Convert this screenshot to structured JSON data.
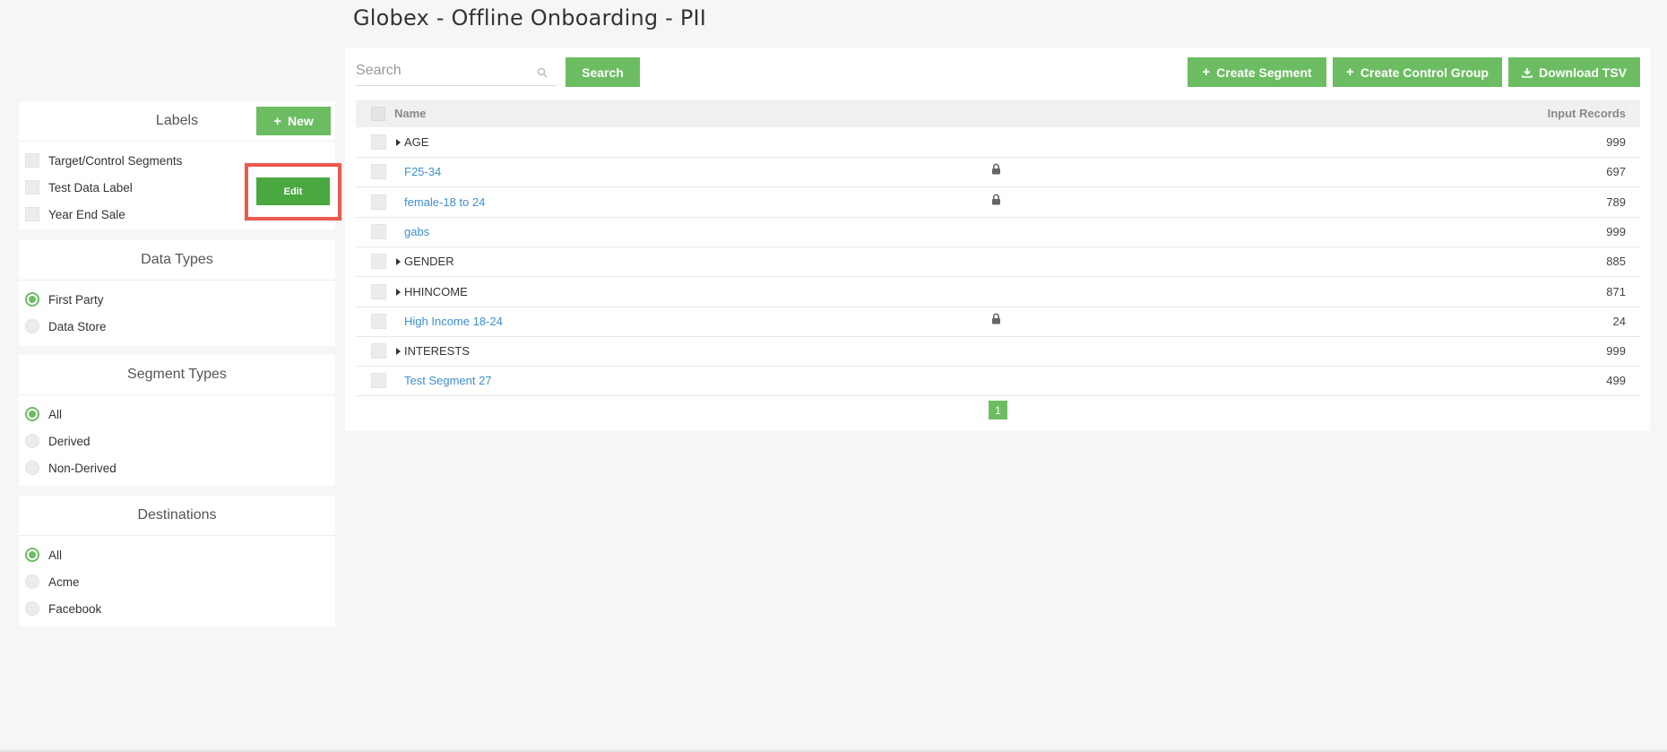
{
  "page": {
    "title": "Globex - Offline Onboarding - PII"
  },
  "labels_panel": {
    "title": "Labels",
    "new_button": "New",
    "edit_button": "Edit",
    "items": [
      "Target/Control Segments",
      "Test Data Label",
      "Year End Sale"
    ]
  },
  "data_types_panel": {
    "title": "Data Types",
    "items": [
      {
        "label": "First Party",
        "selected": true
      },
      {
        "label": "Data Store",
        "selected": false
      }
    ]
  },
  "segment_types_panel": {
    "title": "Segment Types",
    "items": [
      {
        "label": "All",
        "selected": true
      },
      {
        "label": "Derived",
        "selected": false
      },
      {
        "label": "Non-Derived",
        "selected": false
      }
    ]
  },
  "destinations_panel": {
    "title": "Destinations",
    "items": [
      {
        "label": "All",
        "selected": true
      },
      {
        "label": "Acme",
        "selected": false
      },
      {
        "label": "Facebook",
        "selected": false
      }
    ]
  },
  "toolbar": {
    "search_placeholder": "Search",
    "search_button": "Search",
    "create_segment": "Create Segment",
    "create_control_group": "Create Control Group",
    "download_tsv": "Download TSV"
  },
  "table": {
    "col_name": "Name",
    "col_records": "Input Records",
    "rows": [
      {
        "name": "AGE",
        "type": "group",
        "locked": false,
        "records": "999"
      },
      {
        "name": "F25-34",
        "type": "link",
        "locked": true,
        "records": "697"
      },
      {
        "name": "female-18 to 24",
        "type": "link",
        "locked": true,
        "records": "789"
      },
      {
        "name": "gabs",
        "type": "link",
        "locked": false,
        "records": "999"
      },
      {
        "name": "GENDER",
        "type": "group",
        "locked": false,
        "records": "885"
      },
      {
        "name": "HHINCOME",
        "type": "group",
        "locked": false,
        "records": "871"
      },
      {
        "name": "High Income 18-24",
        "type": "link",
        "locked": true,
        "records": "24"
      },
      {
        "name": "INTERESTS",
        "type": "group",
        "locked": false,
        "records": "999"
      },
      {
        "name": "Test Segment 27",
        "type": "link",
        "locked": false,
        "records": "499"
      }
    ]
  },
  "pagination": {
    "current_page": "1"
  },
  "colors": {
    "accent_green": "#6cbd62",
    "link_blue": "#3e8fd1",
    "highlight_red": "#ea5a4f"
  }
}
